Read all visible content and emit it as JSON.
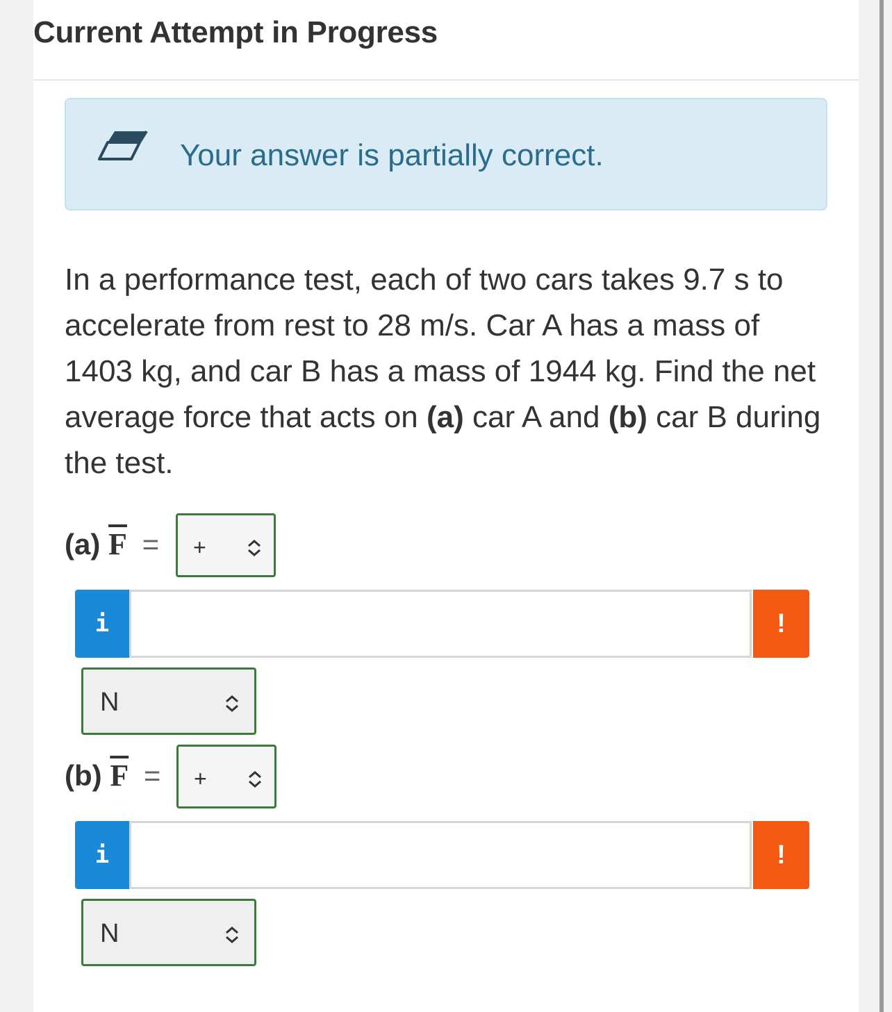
{
  "heading": "Current Attempt in Progress",
  "alert": {
    "text": "Your answer is partially correct.",
    "icon": "eraser-icon"
  },
  "question": {
    "part1": "In a performance test, each of two cars takes 9.7 s to accelerate from rest to 28 m/s. Car A has a mass of 1403 kg, and car B has a mass of 1944 kg. Find the net average force that acts on ",
    "bold_a": "(a)",
    "part2": " car A and ",
    "bold_b": "(b)",
    "part3": " car B during the test."
  },
  "parts": [
    {
      "prefix": "(a)",
      "symbol": "F",
      "equals": "=",
      "sign": "+",
      "value": "",
      "info": "i",
      "warning": "!",
      "unit": "N"
    },
    {
      "prefix": "(b)",
      "symbol": "F",
      "equals": "=",
      "sign": "+",
      "value": "",
      "info": "i",
      "warning": "!",
      "unit": "N"
    }
  ],
  "colors": {
    "info": "#1a8ad8",
    "warning": "#f55a14",
    "select_border": "#3c7a3c",
    "alert_bg": "#d9ecf5"
  }
}
